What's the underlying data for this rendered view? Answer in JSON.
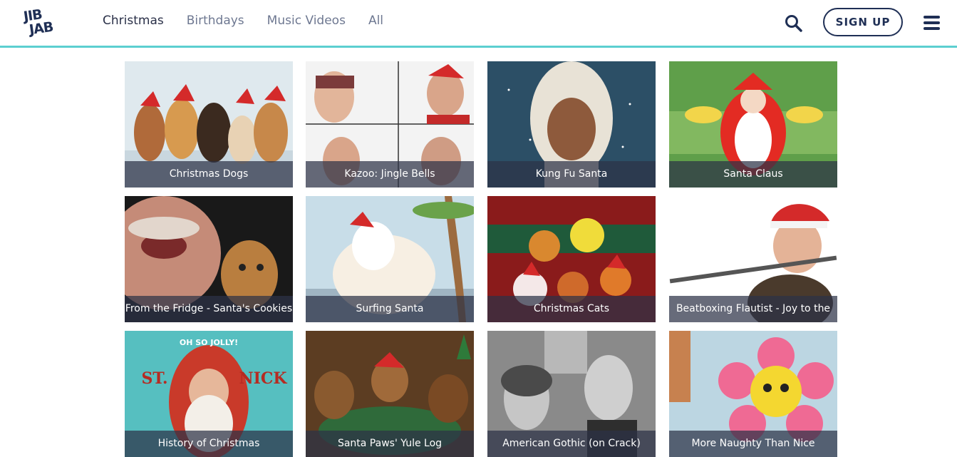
{
  "brand": {
    "logo_line1": "JIB",
    "logo_line2": "JAB"
  },
  "nav": {
    "items": [
      {
        "label": "Christmas",
        "active": true
      },
      {
        "label": "Birthdays",
        "active": false
      },
      {
        "label": "Music Videos",
        "active": false
      },
      {
        "label": "All",
        "active": false
      }
    ]
  },
  "header": {
    "signup_label": "SIGN UP",
    "search_icon": "search-icon",
    "menu_icon": "hamburger-menu-icon"
  },
  "colors": {
    "navy": "#1f2f55",
    "accent": "#5ccfd0",
    "caption_bg": "#2d3246"
  },
  "videos": [
    {
      "title": "Christmas Dogs"
    },
    {
      "title": "Kazoo: Jingle Bells"
    },
    {
      "title": "Kung Fu Santa"
    },
    {
      "title": "Santa Claus"
    },
    {
      "title": "From the Fridge - Santa's Cookies"
    },
    {
      "title": "Surfing Santa"
    },
    {
      "title": "Christmas Cats"
    },
    {
      "title": "Beatboxing Flautist - Joy to the"
    },
    {
      "title": "History of Christmas",
      "art_text_top": "OH SO JOLLY!",
      "art_text_left": "ST.",
      "art_text_right": "NICK"
    },
    {
      "title": "Santa Paws' Yule Log"
    },
    {
      "title": "American Gothic (on Crack)"
    },
    {
      "title": "More Naughty Than Nice"
    }
  ]
}
